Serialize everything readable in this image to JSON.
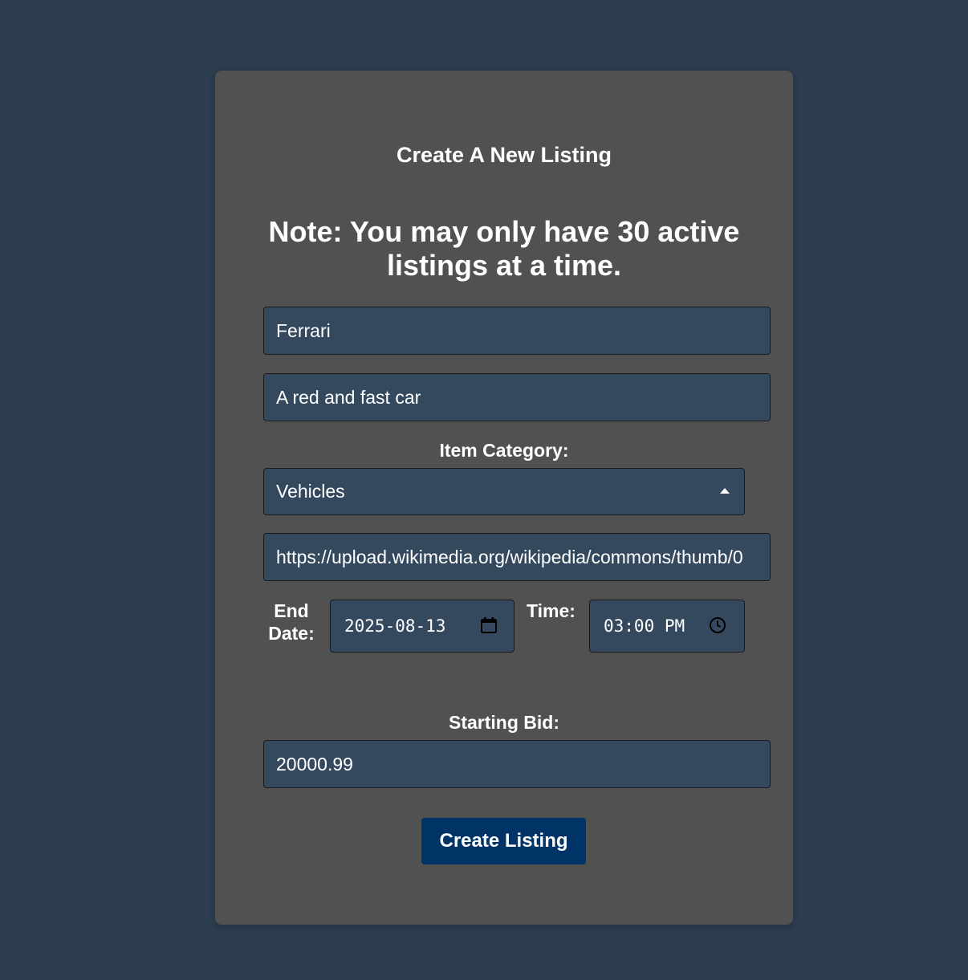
{
  "form": {
    "title": "Create A New Listing",
    "note": "Note: You may only have 30 active listings at a time.",
    "item_name_value": "Ferrari",
    "description_value": "A red and fast car",
    "category_label": "Item Category:",
    "category_value": "Vehicles",
    "image_url_value": "https://upload.wikimedia.org/wikipedia/commons/thumb/0",
    "end_date_label_line1": "End",
    "end_date_label_line2": "Date:",
    "end_date_value": "2025-08-13",
    "time_label": "Time:",
    "time_value": "03:00 PM",
    "starting_bid_label": "Starting Bid:",
    "starting_bid_value": "20000.99",
    "submit_label": "Create Listing"
  },
  "colors": {
    "background": "#2d3e50",
    "card": "#515151",
    "input": "#34495e",
    "button": "#003366"
  },
  "icons": {
    "select_caret": "caret-up-icon",
    "date_picker": "calendar-icon",
    "time_picker": "clock-icon"
  }
}
